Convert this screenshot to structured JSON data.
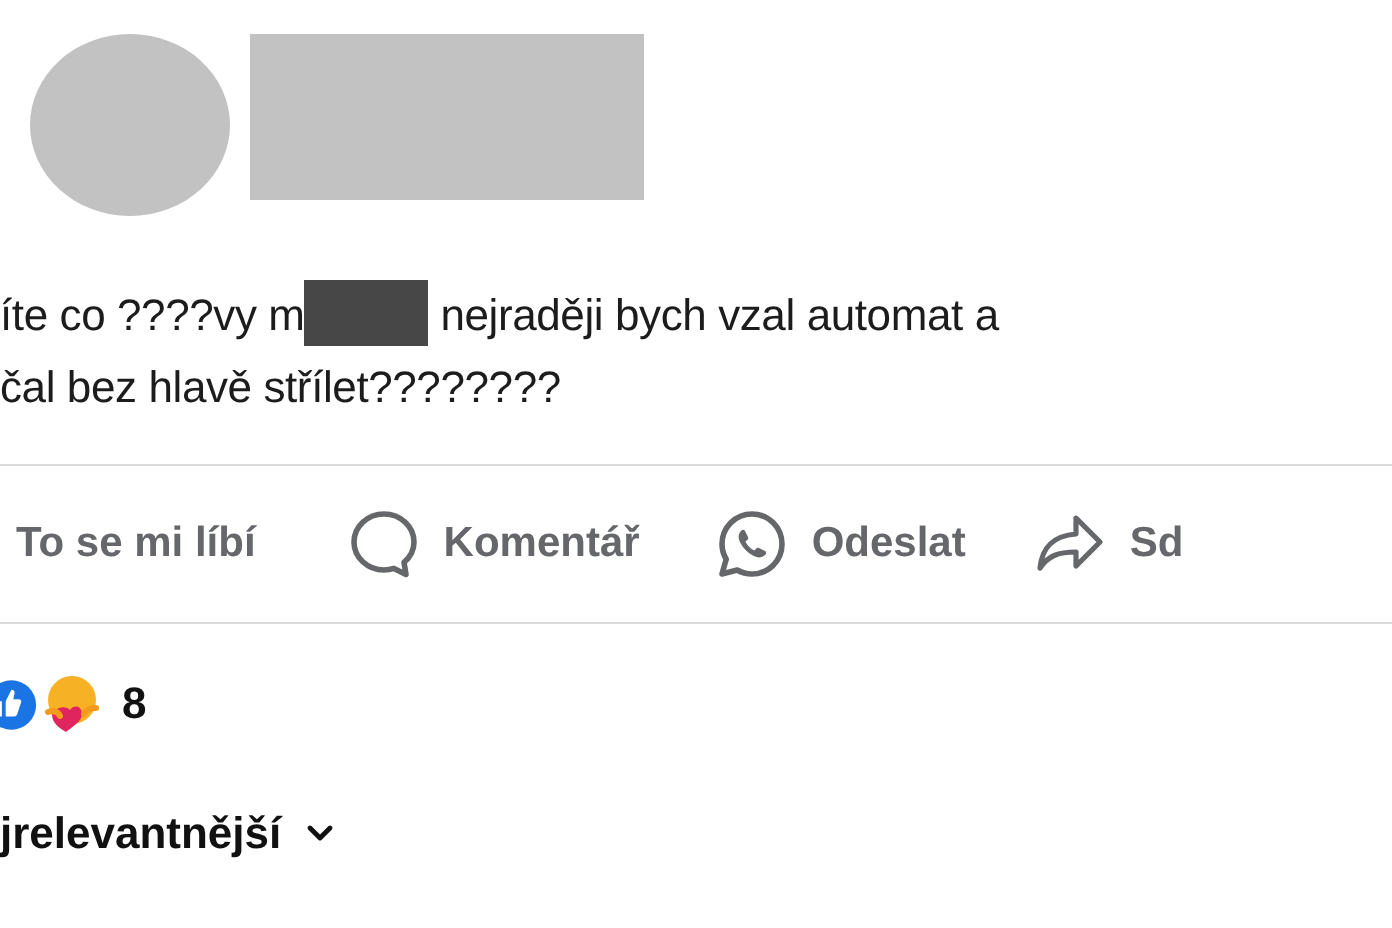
{
  "post": {
    "text_before": "íte co ????vy m",
    "text_after": " nejraději bych vzal automat a",
    "text_line2": "čal bez hlavě střílet????????"
  },
  "actions": [
    {
      "kind": "like",
      "label": "To se mi líbí"
    },
    {
      "kind": "comment",
      "label": "Komentář"
    },
    {
      "kind": "send",
      "label": "Odeslat"
    },
    {
      "kind": "share",
      "label": "Sd"
    }
  ],
  "reactions": {
    "count": "8"
  },
  "sort": {
    "label": "jrelevantnější"
  }
}
